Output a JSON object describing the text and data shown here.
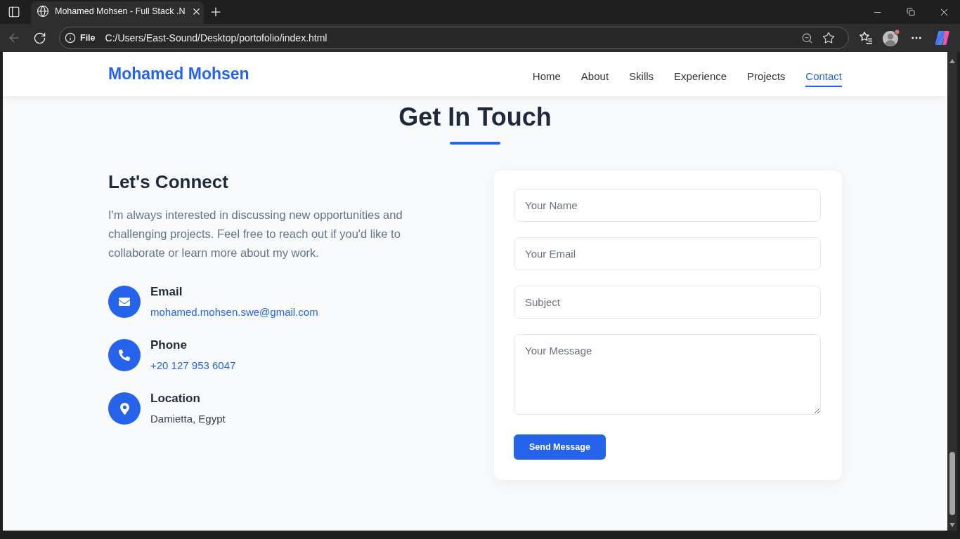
{
  "browser": {
    "tab": {
      "title": "Mohamed Mohsen - Full Stack .N"
    },
    "address_bar": {
      "scheme": "File",
      "url": "C:/Users/East-Sound/Desktop/portofolio/index.html"
    }
  },
  "navbar": {
    "logo": "Mohamed Mohsen",
    "links": [
      {
        "label": "Home",
        "selected": false
      },
      {
        "label": "About",
        "selected": false
      },
      {
        "label": "Skills",
        "selected": false
      },
      {
        "label": "Experience",
        "selected": false
      },
      {
        "label": "Projects",
        "selected": false
      },
      {
        "label": "Contact",
        "selected": true
      }
    ]
  },
  "contact_section": {
    "title": "Get In Touch",
    "connect": {
      "heading": "Let's Connect",
      "text": "I'm always interested in discussing new opportunities and challenging projects. Feel free to reach out if you'd like to collaborate or learn more about my work.",
      "items": [
        {
          "kind": "email",
          "label": "Email",
          "value": "mohamed.mohsen.swe@gmail.com",
          "link": true
        },
        {
          "kind": "phone",
          "label": "Phone",
          "value": "+20 127 953 6047",
          "link": true
        },
        {
          "kind": "location",
          "label": "Location",
          "value": "Damietta, Egypt",
          "link": false
        }
      ]
    },
    "form": {
      "fields": [
        {
          "kind": "input",
          "placeholder": "Your Name"
        },
        {
          "kind": "input",
          "placeholder": "Your Email"
        },
        {
          "kind": "input",
          "placeholder": "Subject"
        },
        {
          "kind": "textarea",
          "placeholder": "Your Message"
        }
      ],
      "submit": "Send Message"
    }
  }
}
